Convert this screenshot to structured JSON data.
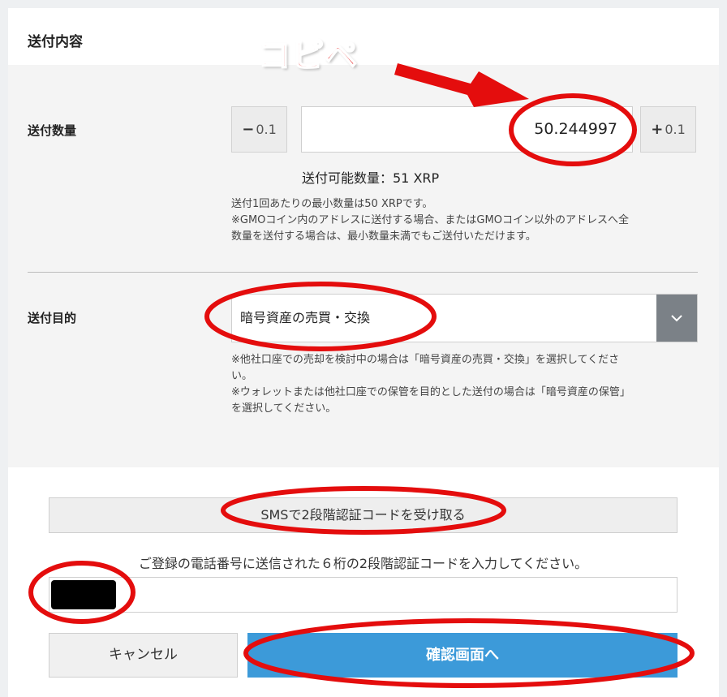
{
  "section": {
    "title": "送付内容"
  },
  "amount": {
    "label": "送付数量",
    "minus_label": "0.1",
    "plus_label": "0.1",
    "minus_sign": "−",
    "plus_sign": "+",
    "value": "50.244997",
    "available": "送付可能数量：51 XRP",
    "note_line1": "送付1回あたりの最小数量は50 XRPです。",
    "note_line2": "※GMOコイン内のアドレスに送付する場合、またはGMOコイン以外のアドレスへ全",
    "note_line3": "数量を送付する場合は、最小数量未満でもご送付いただけます。"
  },
  "purpose": {
    "label": "送付目的",
    "selected": "暗号資産の売買・交換",
    "note_line1": "※他社口座での売却を検討中の場合は「暗号資産の売買・交換」を選択してくださ",
    "note_line2": "い。",
    "note_line3": "※ウォレットまたは他社口座での保管を目的とした送付の場合は「暗号資産の保管」",
    "note_line4": "を選択してください。"
  },
  "sms": {
    "button_label": "SMSで2段階認証コードを受け取る",
    "hint": "ご登録の電話番号に送信された６桁の2段階認証コードを入力してください。"
  },
  "actions": {
    "cancel": "キャンセル",
    "confirm": "確認画面へ"
  },
  "annotation": {
    "text": "コピペ",
    "color": "#e40d0d"
  },
  "icons": {
    "select_arrow": "chevron-down-icon"
  }
}
